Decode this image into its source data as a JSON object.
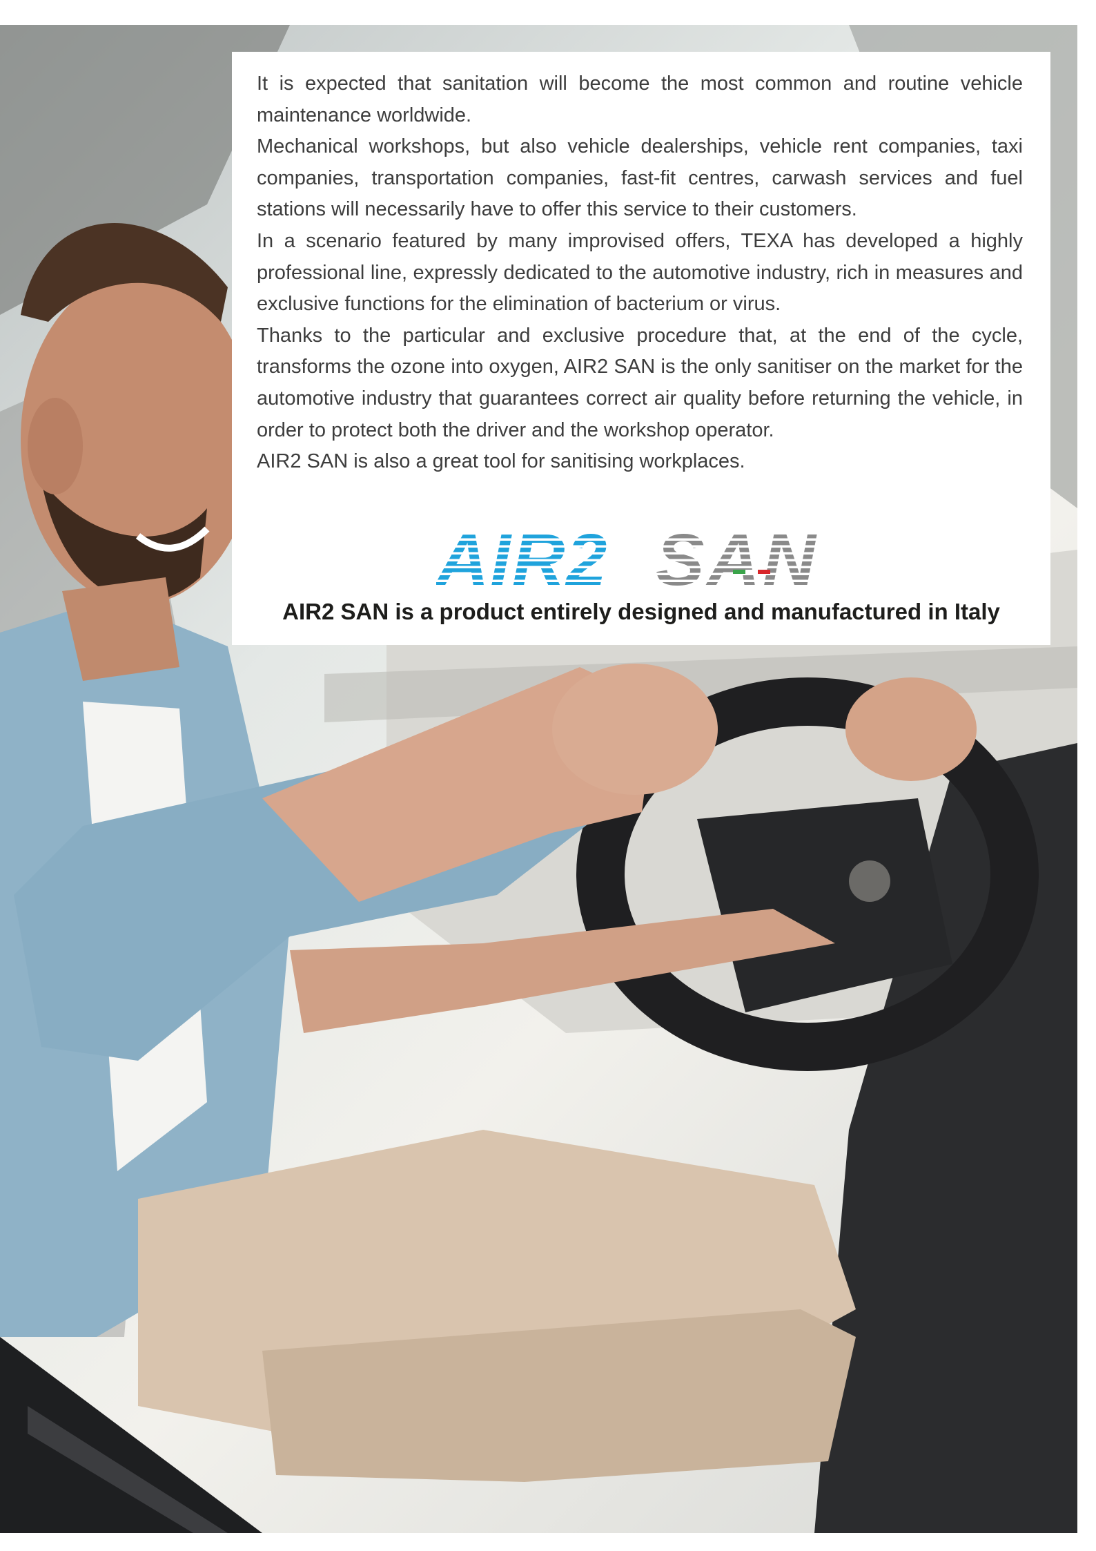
{
  "paragraphs": [
    "It is expected that sanitation will become the most common and routine vehicle maintenance worldwide.",
    "Mechanical workshops, but also vehicle dealerships, vehicle rent companies, taxi companies, transportation companies, fast-fit centres, carwash services and fuel stations will necessarily have to offer this service to their customers.",
    "In a scenario featured by many improvised offers, TEXA has developed a highly professional line, expressly dedicated to the automotive industry, rich in measures and exclusive functions for the elimination of bacterium or virus.",
    "Thanks to the particular and exclusive procedure that, at the end of the cycle, transforms the ozone into oxygen, AIR2 SAN is the only sanitiser on the market for the automotive industry that guarantees correct air quality before returning the vehicle, in order to protect both the driver and the workshop operator.",
    "AIR2 SAN is also a great tool for sanitising workplaces."
  ],
  "logo": {
    "part1": "AIR2",
    "part2": "SAN",
    "color_blue": "#1fa3dc",
    "color_grey": "#8a8a8a",
    "flag_colors": [
      "#3aa44a",
      "#ffffff",
      "#d9252a"
    ]
  },
  "tagline": "AIR2 SAN is a product entirely designed and manufactured in Italy"
}
